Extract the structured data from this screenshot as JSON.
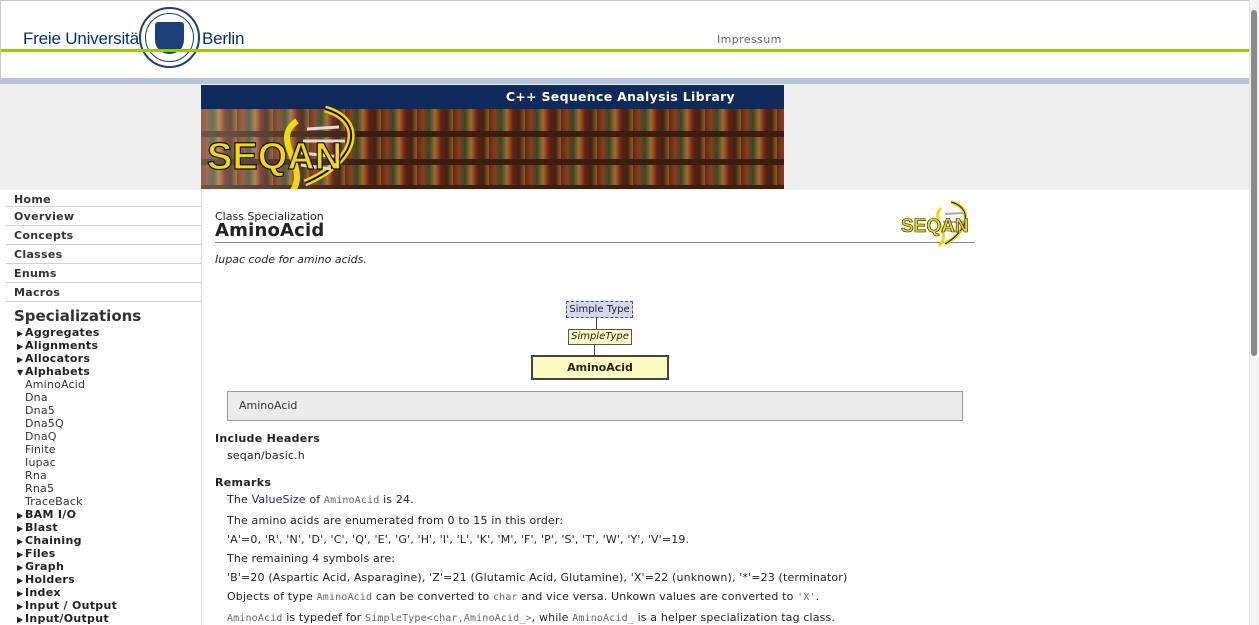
{
  "header": {
    "fu_left": "Freie Universität",
    "fu_right": "Berlin",
    "impressum": "Impressum"
  },
  "banner": {
    "tagline": "C++ Sequence Analysis Library",
    "logo_text": "SEQAN"
  },
  "nav": {
    "main_items": [
      "Home",
      "Overview",
      "Concepts",
      "Classes",
      "Enums",
      "Macros"
    ],
    "specializations_title": "Specializations",
    "categories_before": [
      {
        "label": "Aggregates",
        "expanded": false
      },
      {
        "label": "Alignments",
        "expanded": false
      },
      {
        "label": "Allocators",
        "expanded": false
      },
      {
        "label": "Alphabets",
        "expanded": true
      }
    ],
    "alphabet_items": [
      "AminoAcid",
      "Dna",
      "Dna5",
      "Dna5Q",
      "DnaQ",
      "Finite",
      "Iupac",
      "Rna",
      "Rna5",
      "TraceBack"
    ],
    "categories_after": [
      {
        "label": "BAM I/O",
        "expanded": false
      },
      {
        "label": "Blast",
        "expanded": false
      },
      {
        "label": "Chaining",
        "expanded": false
      },
      {
        "label": "Files",
        "expanded": false
      },
      {
        "label": "Graph",
        "expanded": false
      },
      {
        "label": "Holders",
        "expanded": false
      },
      {
        "label": "Index",
        "expanded": false
      },
      {
        "label": "Input / Output",
        "expanded": false
      },
      {
        "label": "Input/Output",
        "expanded": false
      }
    ]
  },
  "page": {
    "kind": "Class Specialization",
    "name": "AminoAcid",
    "short_description": "Iupac code for amino acids.",
    "diagram": {
      "concept": "Simple Type",
      "parent": "SimpleType",
      "current": "AminoAcid"
    },
    "signature": "AminoAcid",
    "include_headers_title": "Include Headers",
    "include_header": "seqan/basic.h",
    "remarks_title": "Remarks",
    "remarks": {
      "r1_a": "The ",
      "r1_link": "ValueSize",
      "r1_b": " of ",
      "r1_code": "AminoAcid",
      "r1_c": " is 24.",
      "r2": "The amino acids are enumerated from 0 to 15 in this order:",
      "r3": "'A'=0, 'R', 'N', 'D', 'C', 'Q', 'E', 'G', 'H', 'I', 'L', 'K', 'M', 'F', 'P', 'S', 'T', 'W', 'Y', 'V'=19.",
      "r4": "The remaining 4 symbols are:",
      "r5": "'B'=20 (Aspartic Acid, Asparagine), 'Z'=21 (Glutamic Acid, Glutamine), 'X'=22 (unknown), '*'=23 (terminator)",
      "r6_a": "Objects of type ",
      "r6_code1": "AminoAcid",
      "r6_b": " can be converted to ",
      "r6_code2": "char",
      "r6_c": " and vice versa. Unkown values are converted to ",
      "r6_code3": "'X'",
      "r6_d": ".",
      "r7_code1": "AminoAcid",
      "r7_a": " is typedef for ",
      "r7_code2": "SimpleType<char,AminoAcid_>",
      "r7_b": ", while ",
      "r7_code3": "AminoAcid_",
      "r7_c": " is a helper specialization tag class."
    }
  },
  "colors": {
    "fu_blue": "#003366",
    "fu_green": "#99cc00",
    "banner_navy": "#0f2a5a",
    "seqan_yellow": "#f2d813",
    "link": "#1a237e"
  }
}
